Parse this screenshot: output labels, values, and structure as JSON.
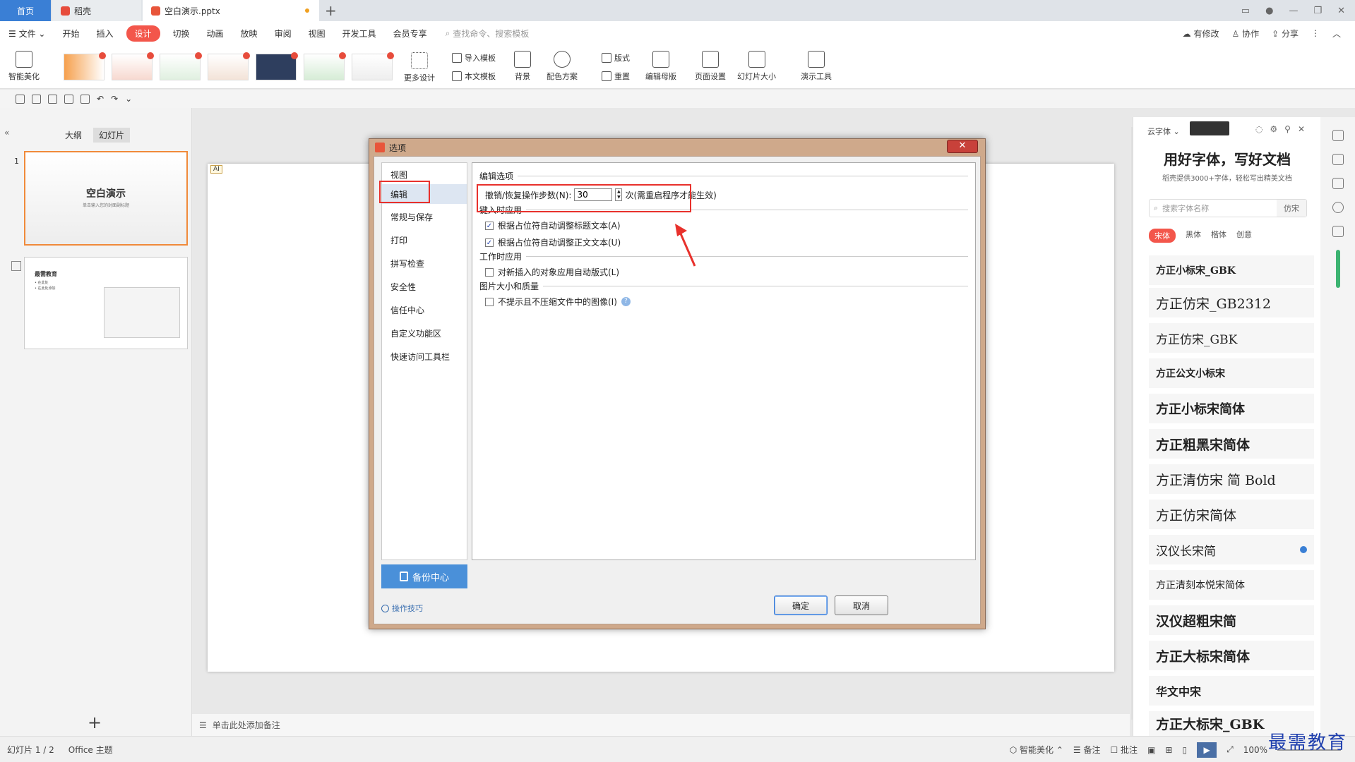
{
  "tabs": {
    "home": "首页",
    "docer": "稻壳",
    "file": "空白演示.pptx",
    "add": "+"
  },
  "menu": {
    "file": "文件",
    "items": [
      "开始",
      "插入",
      "设计",
      "切换",
      "动画",
      "放映",
      "审阅",
      "视图",
      "开发工具",
      "会员专享"
    ],
    "active": "设计",
    "search_placeholder": "查找命令、搜索模板",
    "right": [
      "有修改",
      "协作",
      "分享"
    ]
  },
  "ribbon": {
    "smart": "智能美化",
    "more_design": "更多设计",
    "import_tpl": "导入模板",
    "this_tpl": "本文模板",
    "background": "背景",
    "color_scheme": "配色方案",
    "layout": "版式",
    "reset": "重置",
    "edit_master": "编辑母版",
    "page_setup": "页面设置",
    "slide_size": "幻灯片大小",
    "present_tools": "演示工具"
  },
  "left": {
    "tab_outline": "大纲",
    "tab_slides": "幻灯片",
    "slide1_num": "1",
    "slide1_title": "空白演示",
    "slide1_sub": "单击输入您的封面副标题",
    "slide2_title": "最需教育",
    "slide2_b1": "• 在此处",
    "slide2_b2": "• 在此处添加",
    "add": "+"
  },
  "notes": "单击此处添加备注",
  "dialog": {
    "title": "选项",
    "close": "✕",
    "nav": [
      "视图",
      "编辑",
      "常规与保存",
      "打印",
      "拼写检查",
      "安全性",
      "信任中心",
      "自定义功能区",
      "快速访问工具栏"
    ],
    "selected_nav": "编辑",
    "sec_edit": "编辑选项",
    "undo_label": "撤销/恢复操作步数(N):",
    "undo_value": "30",
    "undo_note": "次(需重启程序才能生效)",
    "sec_typing": "键入时应用",
    "chk1": "根据占位符自动调整标题文本(A)",
    "chk1_checked": true,
    "chk2": "根据占位符自动调整正文文本(U)",
    "chk2_checked": true,
    "sec_work": "工作时应用",
    "chk3": "对新插入的对象应用自动版式(L)",
    "chk3_checked": false,
    "sec_image": "图片大小和质量",
    "chk4": "不提示且不压缩文件中的图像(I)",
    "chk4_checked": false,
    "backup": "备份中心",
    "tips": "操作技巧",
    "ok": "确定",
    "cancel": "取消"
  },
  "rightpanel": {
    "cloud_font": "云字体",
    "title": "用好字体，写好文档",
    "subtitle": "稻壳提供3000+字体，轻松写出精美文档",
    "search_placeholder": "搜索字体名称",
    "search_fz": "仿宋",
    "cats": [
      "宋体",
      "黑体",
      "楷体",
      "创意"
    ],
    "fonts": [
      "方正小标宋_GBK",
      "方正仿宋_GB2312",
      "方正仿宋_GBK",
      "方正公文小标宋",
      "方正小标宋简体",
      "方正粗黑宋简体",
      "方正清仿宋 简 Bold",
      "方正仿宋简体",
      "汉仪长宋简",
      "方正清刻本悦宋简体",
      "汉仪超粗宋简",
      "方正大标宋简体",
      "华文中宋",
      "方正大标宋_GBK"
    ]
  },
  "status": {
    "slide_info": "幻灯片 1 / 2",
    "theme": "Office 主题",
    "smart": "智能美化",
    "notes": "备注",
    "comments": "批注",
    "zoom": "100%"
  },
  "watermark": "最需教育",
  "colors": {
    "accent": "#f3564b",
    "home_tab": "#3a7fd5",
    "highlight": "#e8312c"
  }
}
